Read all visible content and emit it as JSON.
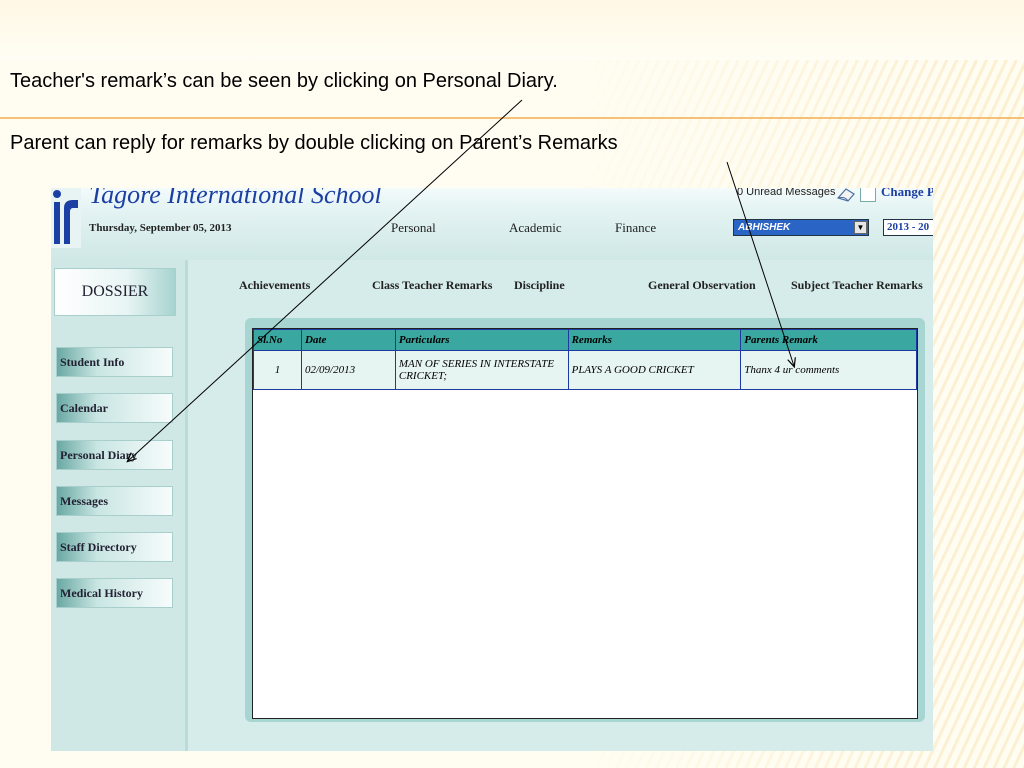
{
  "slide": {
    "caption_1": "Teacher's remark’s can be seen by clicking on Personal Diary.",
    "caption_2": "Parent can reply for remarks by double clicking on Parent’s Remarks",
    "accent_color": "#f2b25a"
  },
  "app": {
    "school_name": "Tagore International School",
    "date": "Thursday, September 05, 2013",
    "top_nav": [
      "Personal",
      "Academic",
      "Finance"
    ],
    "unread_messages": "0 Unread Messages",
    "change_link": "Change P",
    "student_select": "ABHISHEK",
    "year_select": "2013 - 20"
  },
  "sidebar": {
    "header": "DOSSIER",
    "items": [
      {
        "label": "Student Info"
      },
      {
        "label": "Calendar"
      },
      {
        "label": "Personal Diary"
      },
      {
        "label": "Messages"
      },
      {
        "label": "Staff Directory"
      },
      {
        "label": "Medical History"
      }
    ]
  },
  "subtabs": [
    "Achievements",
    "Class Teacher Remarks",
    "Discipline",
    "General Observation",
    "Subject Teacher Remarks"
  ],
  "table": {
    "headers": [
      "Sl.No",
      "Date",
      "Particulars",
      "Remarks",
      "Parents Remark"
    ],
    "rows": [
      [
        "1",
        "02/09/2013",
        "MAN OF SERIES IN INTERSTATE CRICKET;",
        "PLAYS A GOOD CRICKET",
        "Thanx 4 ur comments"
      ]
    ]
  },
  "colors": {
    "header_cell": "#3aa7a0",
    "grid_border": "#1c3aa0",
    "school_name": "#1b3fa3"
  }
}
